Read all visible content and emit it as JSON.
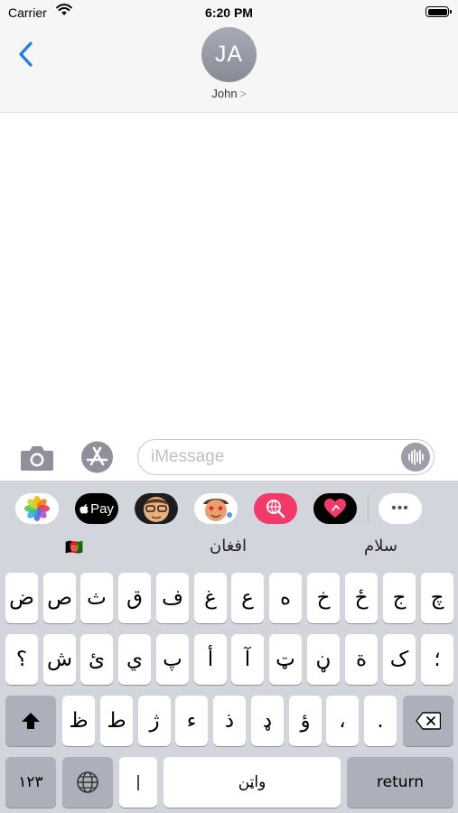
{
  "status": {
    "carrier": "Carrier",
    "time": "6:20 PM"
  },
  "header": {
    "avatar_initials": "JA",
    "contact_name": "John",
    "contact_chevron": ">"
  },
  "compose": {
    "placeholder": "iMessage"
  },
  "app_drawer": {
    "apple_pay_label": "Pay",
    "more_label": "•••"
  },
  "suggestions": {
    "left": "🇦🇫",
    "middle": "افغان",
    "right": "سلام"
  },
  "keyboard": {
    "row1": [
      "ض",
      "ص",
      "ث",
      "ق",
      "ف",
      "غ",
      "ع",
      "ه",
      "خ",
      "ځ",
      "ج",
      "چ"
    ],
    "row2": [
      "؟",
      "ش",
      "ئ",
      "ي",
      "پ",
      "أ",
      "آ",
      "ټ",
      "ڼ",
      "ة",
      "ک",
      "؛"
    ],
    "row3": [
      "ظ",
      "ط",
      "ژ",
      "ء",
      "ذ",
      "ډ",
      "ؤ",
      "،",
      "."
    ],
    "numbers_key": "١٢٣",
    "zwnj_key": "|",
    "space_key": "واټن",
    "return_key": "return"
  }
}
